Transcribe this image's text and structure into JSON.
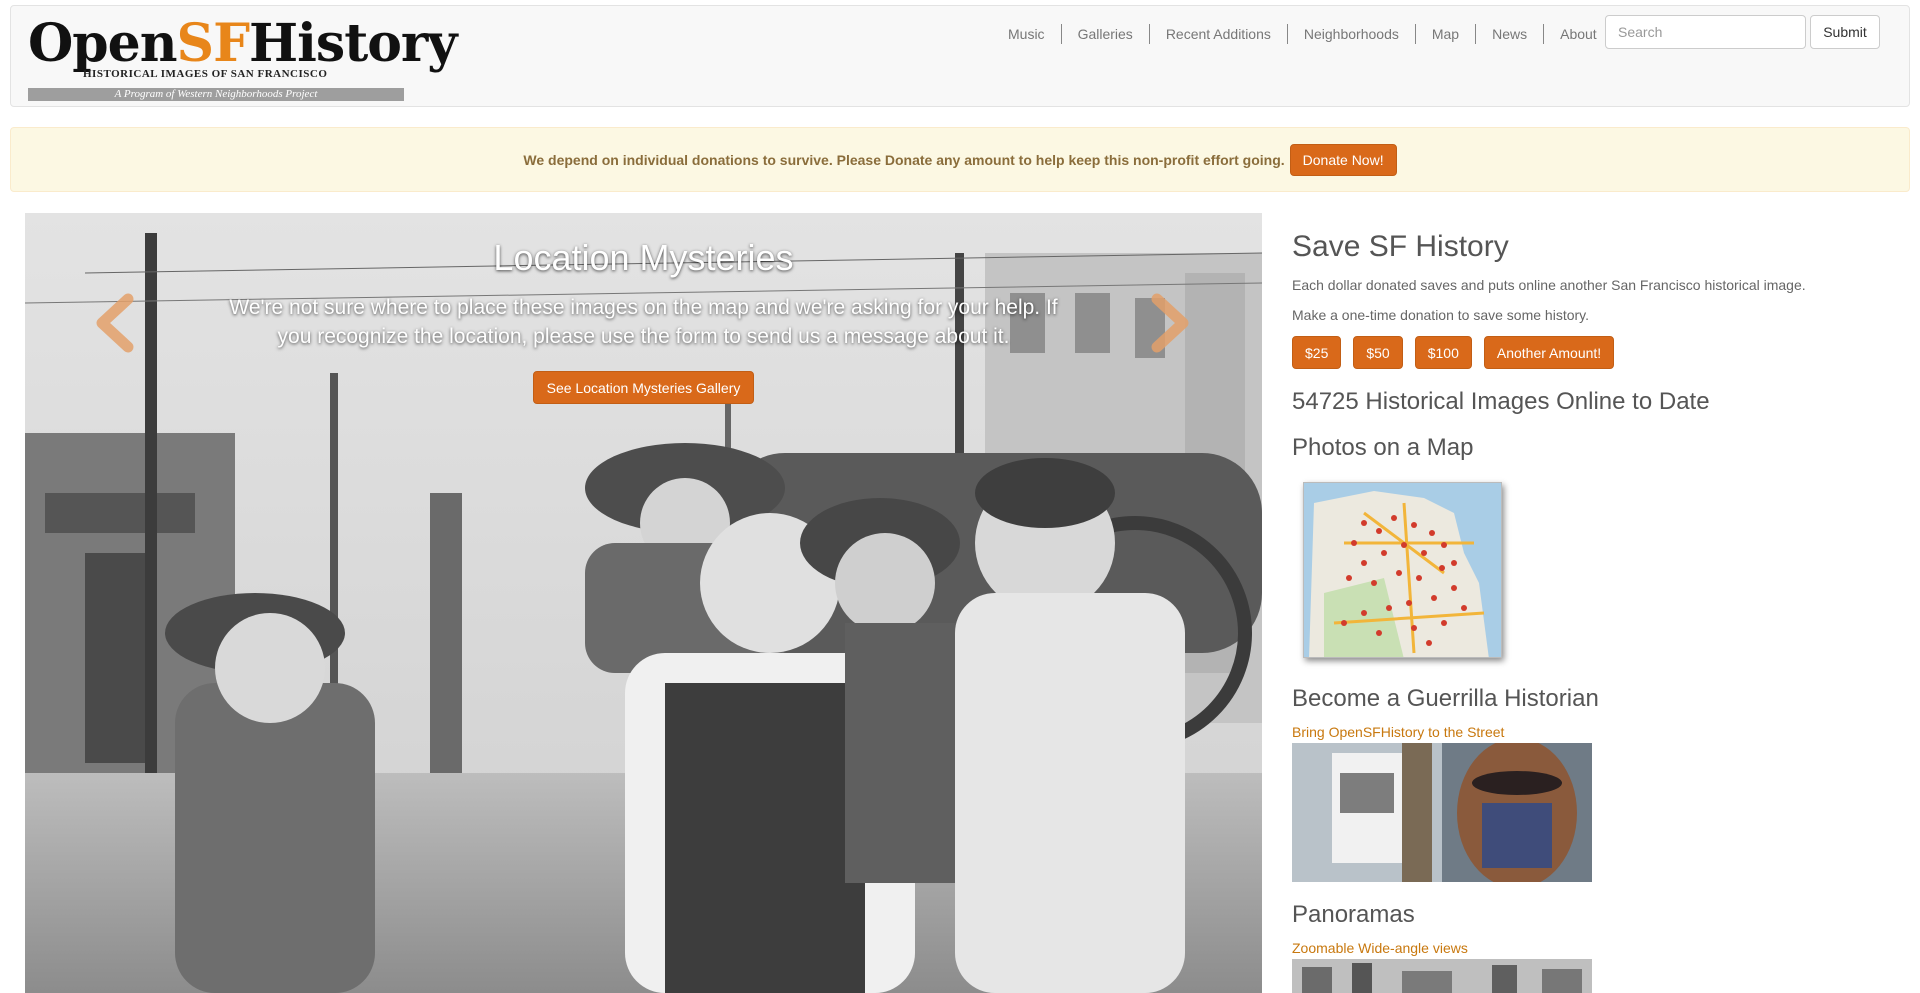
{
  "header": {
    "logo": {
      "title_part1": "Open",
      "title_accent": "SF",
      "title_part2": "History",
      "subtitle": "HISTORICAL IMAGES OF SAN FRANCISCO",
      "tagline": "A Program of Western Neighborhoods Project"
    },
    "nav": [
      "Music",
      "Galleries",
      "Recent Additions",
      "Neighborhoods",
      "Map",
      "News",
      "About"
    ],
    "search": {
      "placeholder": "Search",
      "submit_label": "Submit"
    }
  },
  "banner": {
    "text": "We depend on individual donations to survive. Please Donate any amount to help keep this non-profit effort going.",
    "button_label": "Donate Now!"
  },
  "carousel": {
    "title": "Location Mysteries",
    "text": "We're not sure where to place these images on the map and we're asking for your help. If you recognize the location, please use the form to send us a message about it.",
    "button_label": "See Location Mysteries Gallery",
    "prev_icon": "chevron-left-icon",
    "next_icon": "chevron-right-icon"
  },
  "sidebar": {
    "save_heading": "Save SF History",
    "save_text1": "Each dollar donated saves and puts online another San Francisco historical image.",
    "save_text2": "Make a one-time donation to save some history.",
    "amounts": [
      "$25",
      "$50",
      "$100",
      "Another Amount!"
    ],
    "count_heading": "54725 Historical Images Online to Date",
    "map_heading": "Photos on a Map",
    "guerrilla_heading": "Become a Guerrilla Historian",
    "guerrilla_link": "Bring OpenSFHistory to the Street",
    "panoramas_heading": "Panoramas",
    "panoramas_link": "Zoomable Wide-angle views"
  },
  "colors": {
    "accent": "#d9691a",
    "link": "#c8780e",
    "banner_bg": "#fcf8e3",
    "banner_text": "#8a6d3b"
  }
}
